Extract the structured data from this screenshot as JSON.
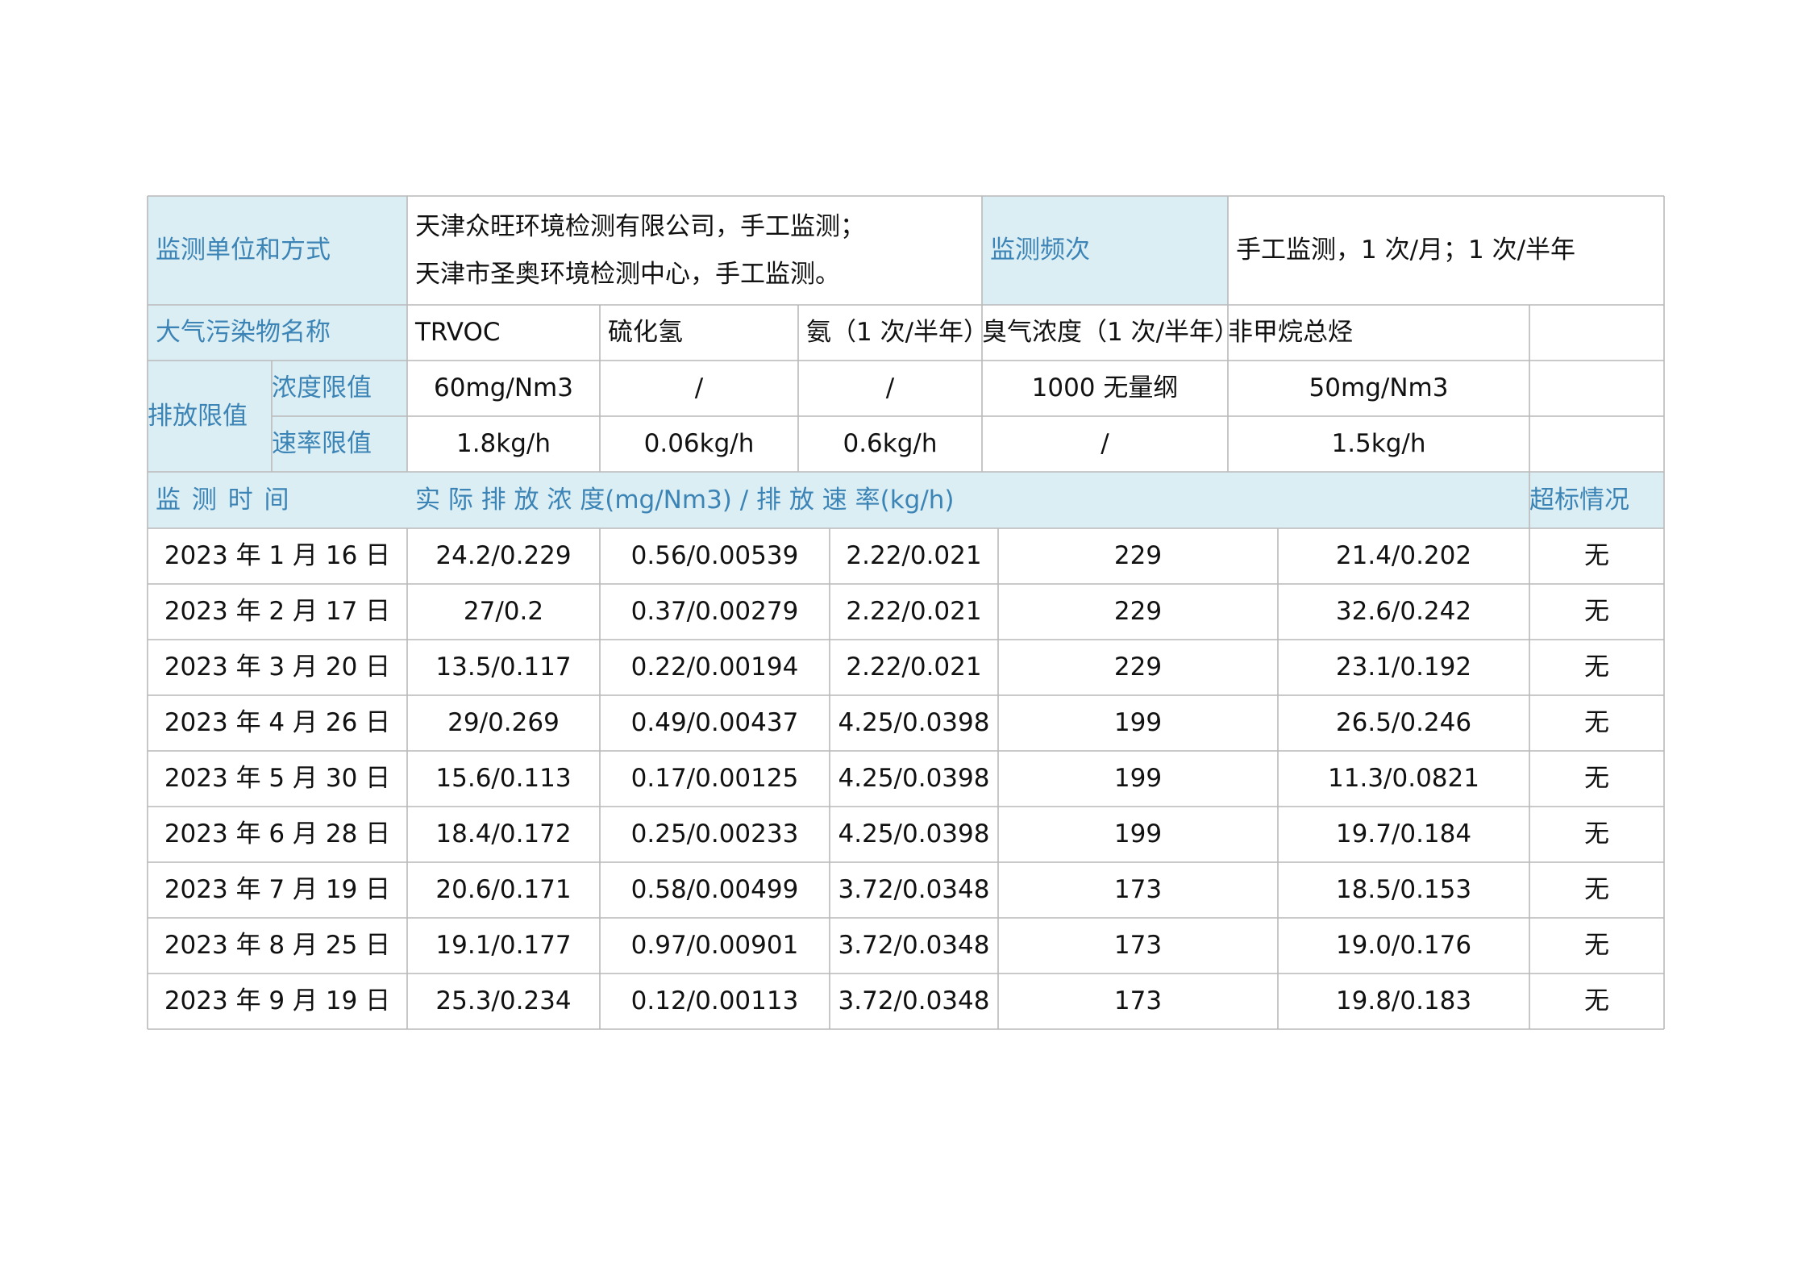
{
  "info": {
    "unit_label": "监测单位和方式",
    "unit_value_line1": "天津众旺环境检测有限公司，手工监测；",
    "unit_value_line2": "天津市圣奥环境检测中心，手工监测。",
    "freq_label": "监测频次",
    "freq_value": "手工监测，1 次/月；1 次/半年"
  },
  "pollutants": {
    "label": "大气污染物名称",
    "names": [
      "TRVOC",
      "硫化氢",
      "氨（1 次/半年）",
      "臭气浓度（1 次/半年）",
      "非甲烷总烃"
    ]
  },
  "limits": {
    "label": "排放限值",
    "conc_label": "浓度限值",
    "rate_label": "速率限值",
    "conc": [
      "60mg/Nm3",
      "/",
      "/",
      "1000 无量纲",
      "50mg/Nm3"
    ],
    "rate": [
      "1.8kg/h",
      "0.06kg/h",
      "0.6kg/h",
      "/",
      "1.5kg/h"
    ]
  },
  "measure_header": {
    "time_label": "监 测 时 间",
    "value_label": "实 际 排 放 浓 度(mg/Nm3) / 排 放 速 率(kg/h)",
    "exceed_label": "超标情况"
  },
  "rows": [
    {
      "date": "2023 年 1 月 16 日",
      "v": [
        "24.2/0.229",
        "0.56/0.00539",
        "2.22/0.021",
        "229",
        "21.4/0.202"
      ],
      "exceed": "无"
    },
    {
      "date": "2023 年 2 月 17 日",
      "v": [
        "27/0.2",
        "0.37/0.00279",
        "2.22/0.021",
        "229",
        "32.6/0.242"
      ],
      "exceed": "无"
    },
    {
      "date": "2023 年 3 月 20 日",
      "v": [
        "13.5/0.117",
        "0.22/0.00194",
        "2.22/0.021",
        "229",
        "23.1/0.192"
      ],
      "exceed": "无"
    },
    {
      "date": "2023 年 4 月 26 日",
      "v": [
        "29/0.269",
        "0.49/0.00437",
        "4.25/0.0398",
        "199",
        "26.5/0.246"
      ],
      "exceed": "无"
    },
    {
      "date": "2023 年 5 月 30 日",
      "v": [
        "15.6/0.113",
        "0.17/0.00125",
        "4.25/0.0398",
        "199",
        "11.3/0.0821"
      ],
      "exceed": "无"
    },
    {
      "date": "2023 年 6 月 28 日",
      "v": [
        "18.4/0.172",
        "0.25/0.00233",
        "4.25/0.0398",
        "199",
        "19.7/0.184"
      ],
      "exceed": "无"
    },
    {
      "date": "2023 年 7 月 19 日",
      "v": [
        "20.6/0.171",
        "0.58/0.00499",
        "3.72/0.0348",
        "173",
        "18.5/0.153"
      ],
      "exceed": "无"
    },
    {
      "date": "2023 年 8 月 25 日",
      "v": [
        "19.1/0.177",
        "0.97/0.00901",
        "3.72/0.0348",
        "173",
        "19.0/0.176"
      ],
      "exceed": "无"
    },
    {
      "date": "2023 年 9 月 19 日",
      "v": [
        "25.3/0.234",
        "0.12/0.00113",
        "3.72/0.0348",
        "173",
        "19.8/0.183"
      ],
      "exceed": "无"
    }
  ]
}
